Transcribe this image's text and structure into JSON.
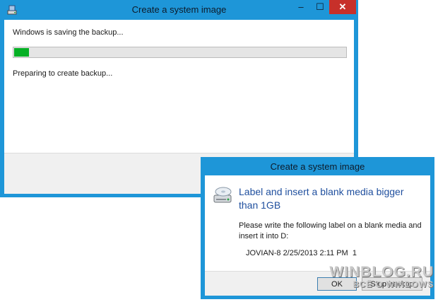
{
  "main_window": {
    "title": "Create a system image",
    "status_line": "Windows is saving the backup...",
    "progress_fraction": 0.045,
    "detail_line": "Preparing to create backup...",
    "controls": {
      "minimize": "–",
      "maximize": "☐",
      "close": "✕"
    }
  },
  "dialog": {
    "title": "Create a system image",
    "heading": "Label and insert a blank media bigger than 1GB",
    "instruction": "Please write the following label on a blank media and insert it into D:",
    "media_label": "JOVIAN-8 2/25/2013 2:11 PM  1",
    "buttons": {
      "ok": "OK",
      "stop": "Stop backup"
    }
  },
  "watermark": {
    "line1": "WINBLOG.RU",
    "line2": "ВСЁ О WINDOWS"
  },
  "colors": {
    "frame": "#1e96d8",
    "progress": "#06b025",
    "close": "#c7302a",
    "heading": "#1f4f9e"
  },
  "icons": [
    "backup-app-icon",
    "drive-icon"
  ]
}
